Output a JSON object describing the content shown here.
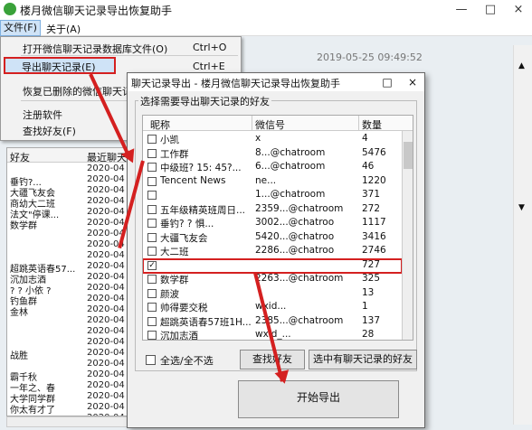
{
  "app": {
    "title": "楼月微信聊天记录导出恢复助手"
  },
  "menubar": {
    "file": "文件(F)",
    "about": "关于(A)"
  },
  "file_menu": [
    {
      "label": "打开微信聊天记录数据库文件(O)",
      "shortcut": "Ctrl+O"
    },
    {
      "label": "导出聊天记录(E)",
      "shortcut": "Ctrl+E"
    },
    {
      "label": "恢复已删除的微信聊天记",
      "shortcut": ""
    },
    {
      "label": "注册软件",
      "shortcut": ""
    },
    {
      "label": "查找好友(F)",
      "shortcut": ""
    }
  ],
  "main": {
    "timestamp": "2019-05-25 09:49:52"
  },
  "left_list": {
    "headers": [
      "好友",
      "最近聊天"
    ],
    "rows": [
      [
        "",
        "2020-04"
      ],
      [
        "垂钓?...",
        "2020-04"
      ],
      [
        "大疆飞友会",
        "2020-04"
      ],
      [
        "商幼大二班",
        "2020-04"
      ],
      [
        "法文\"停课...",
        "2020-04"
      ],
      [
        "数学群",
        "2020-04"
      ],
      [
        "",
        "2020-04"
      ],
      [
        "",
        "2020-04"
      ],
      [
        "",
        "2020-04"
      ],
      [
        "超跳英语春57...",
        "2020-04"
      ],
      [
        "沉加志酒",
        "2020-04"
      ],
      [
        "? ? 小依 ?",
        "2020-04"
      ],
      [
        "钓鱼群",
        "2020-04"
      ],
      [
        "金林",
        "2020-04"
      ],
      [
        "",
        "2020-04"
      ],
      [
        "",
        "2020-04"
      ],
      [
        "",
        "2020-04"
      ],
      [
        "战胜",
        "2020-04"
      ],
      [
        "",
        "2020-04"
      ],
      [
        "霸千秋",
        "2020-04"
      ],
      [
        "一年之、春",
        "2020-04"
      ],
      [
        "大学同学群",
        "2020-04"
      ],
      [
        "你太有才了",
        "2020-04"
      ],
      [
        "",
        "2020-04"
      ]
    ]
  },
  "dialog": {
    "title": "聊天记录导出 - 楼月微信聊天记录导出恢复助手",
    "group_label": "选择需要导出聊天记录的好友",
    "headers": [
      "昵称",
      "微信号",
      "数量"
    ],
    "rows": [
      {
        "checked": false,
        "name": "小凯",
        "id": "x",
        "count": "4"
      },
      {
        "checked": false,
        "name": "工作群",
        "id": "8...@chatroom",
        "count": "5476"
      },
      {
        "checked": false,
        "name": "中级班? 15: 45?...",
        "id": "6...@chatroom",
        "count": "46"
      },
      {
        "checked": false,
        "name": "Tencent News",
        "id": "ne...",
        "count": "1220"
      },
      {
        "checked": false,
        "name": "",
        "id": "1...@chatroom",
        "count": "371"
      },
      {
        "checked": false,
        "name": "五年级精英班周日...",
        "id": "2359...@chatroom",
        "count": "272"
      },
      {
        "checked": false,
        "name": "垂钓? ? 惧...",
        "id": "3002...@chatroo",
        "count": "1117"
      },
      {
        "checked": false,
        "name": "大疆飞友会",
        "id": "5420...@chatroo",
        "count": "3416"
      },
      {
        "checked": false,
        "name": "大二班",
        "id": "2286...@chatroo",
        "count": "2746"
      },
      {
        "checked": true,
        "name": "",
        "id": "",
        "count": "727"
      },
      {
        "checked": false,
        "name": "数学群",
        "id": "2263...@chatroom",
        "count": "325"
      },
      {
        "checked": false,
        "name": "颜波",
        "id": "",
        "count": "13"
      },
      {
        "checked": false,
        "name": "帅得要交税",
        "id": "wxid...",
        "count": "1"
      },
      {
        "checked": false,
        "name": "超跳英语春57班1H...",
        "id": "2385...@chatroom",
        "count": "137"
      },
      {
        "checked": false,
        "name": "沉加志酒",
        "id": "wxid_...",
        "count": "28"
      }
    ],
    "select_all": "全选/全不选",
    "find_friend": "查找好友",
    "select_with_history": "选中有聊天记录的好友",
    "start_export": "开始导出",
    "close": "×"
  },
  "colors": {
    "highlight": "#d42020",
    "selection": "#cfe3f7",
    "app_icon": "#3aa23a"
  },
  "icons": {
    "app": "wechat-logo-icon",
    "minimize": "minimize-icon",
    "maximize": "maximize-icon",
    "close": "close-icon"
  }
}
